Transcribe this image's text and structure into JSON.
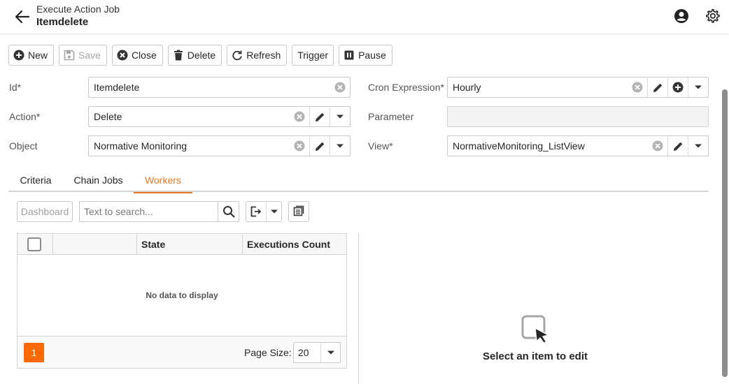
{
  "header": {
    "subtitle": "Execute Action Job",
    "title": "Itemdelete"
  },
  "toolbar": {
    "new_label": "New",
    "save_label": "Save",
    "close_label": "Close",
    "delete_label": "Delete",
    "refresh_label": "Refresh",
    "trigger_label": "Trigger",
    "pause_label": "Pause"
  },
  "form": {
    "id_label": "Id*",
    "id_value": "Itemdelete",
    "action_label": "Action*",
    "action_value": "Delete",
    "object_label": "Object",
    "object_value": "Normative Monitoring",
    "cron_label": "Cron Expression*",
    "cron_value": "Hourly",
    "parameter_label": "Parameter",
    "parameter_value": "",
    "view_label": "View*",
    "view_value": "NormativeMonitoring_ListView"
  },
  "tabs": {
    "criteria": "Criteria",
    "chain_jobs": "Chain Jobs",
    "workers": "Workers",
    "active": "Workers"
  },
  "workers": {
    "dashboard_label": "Dashboard",
    "search_placeholder": "Text to search...",
    "grid": {
      "columns": [
        "",
        "",
        "State",
        "Executions Count"
      ],
      "rows": [],
      "empty_text": "No data to display",
      "current_page": "1",
      "page_size_label": "Page Size:",
      "page_size_value": "20"
    },
    "detail_empty_text": "Select an item to edit"
  },
  "colors": {
    "accent": "#e87722",
    "pager_active": "#ff6a00"
  },
  "icons": {
    "back": "arrow-left-icon",
    "account": "account-circle-icon",
    "settings": "gear-icon"
  }
}
